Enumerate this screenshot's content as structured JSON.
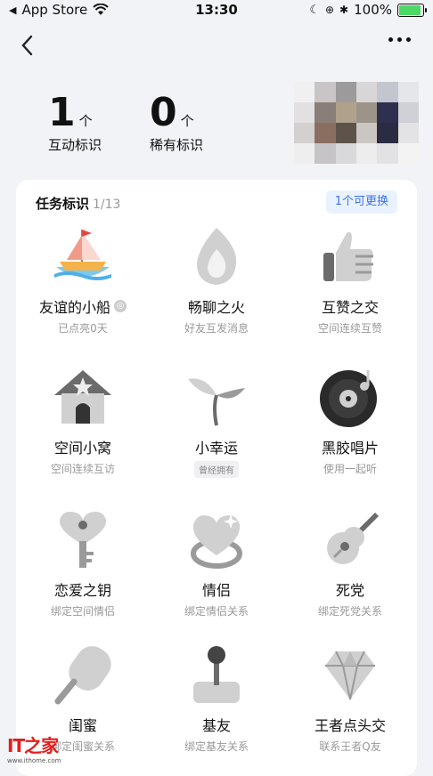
{
  "status_bar": {
    "back_app": "App Store",
    "time": "13:30",
    "battery": "100%"
  },
  "stats": [
    {
      "value": "1",
      "unit": "个",
      "label": "互动标识"
    },
    {
      "value": "0",
      "unit": "个",
      "label": "稀有标识"
    }
  ],
  "avatar_colors": [
    "#f0f0f2",
    "#c9c4c6",
    "#9d9a9c",
    "#d9d6d8",
    "#c3c6cf",
    "#e4e6ea",
    "#e2e0e1",
    "#8a7f78",
    "#b0a18a",
    "#9c9488",
    "#2e3050",
    "#cfd1d6",
    "#d4d0cf",
    "#8a6f60",
    "#5d534b",
    "#cac7c2",
    "#2b2b42",
    "#e3e3e5",
    "#eeeeef",
    "#c6c4c6",
    "#d9d9db",
    "#ededee",
    "#e2e2e4",
    "#f3f3f4"
  ],
  "card": {
    "title": "任务标识",
    "count": "1/13",
    "replace_button": "1个可更换"
  },
  "badges": [
    {
      "name": "友谊的小船",
      "sub": "已点亮0天",
      "icon": "boat-icon",
      "active": true,
      "info": true
    },
    {
      "name": "畅聊之火",
      "sub": "好友互发消息",
      "icon": "fire-icon"
    },
    {
      "name": "互赞之交",
      "sub": "空间连续互赞",
      "icon": "thumbs-up-icon"
    },
    {
      "name": "空间小窝",
      "sub": "空间连续互访",
      "icon": "house-icon"
    },
    {
      "name": "小幸运",
      "sub": "曾经拥有",
      "icon": "sprout-icon",
      "tag": true
    },
    {
      "name": "黑胶唱片",
      "sub": "使用一起听",
      "icon": "vinyl-record-icon"
    },
    {
      "name": "恋爱之钥",
      "sub": "绑定空间情侣",
      "icon": "heart-key-icon"
    },
    {
      "name": "情侣",
      "sub": "绑定情侣关系",
      "icon": "heart-ring-icon"
    },
    {
      "name": "死党",
      "sub": "绑定死党关系",
      "icon": "guitar-icon"
    },
    {
      "name": "闺蜜",
      "sub": "绑定闺蜜关系",
      "icon": "popsicle-icon"
    },
    {
      "name": "基友",
      "sub": "绑定基友关系",
      "icon": "joystick-icon"
    },
    {
      "name": "王者点头交",
      "sub": "联系王者Q友",
      "icon": "diamond-icon"
    }
  ],
  "watermark": {
    "logo": "IT之家",
    "url": "www.ithome.com"
  }
}
